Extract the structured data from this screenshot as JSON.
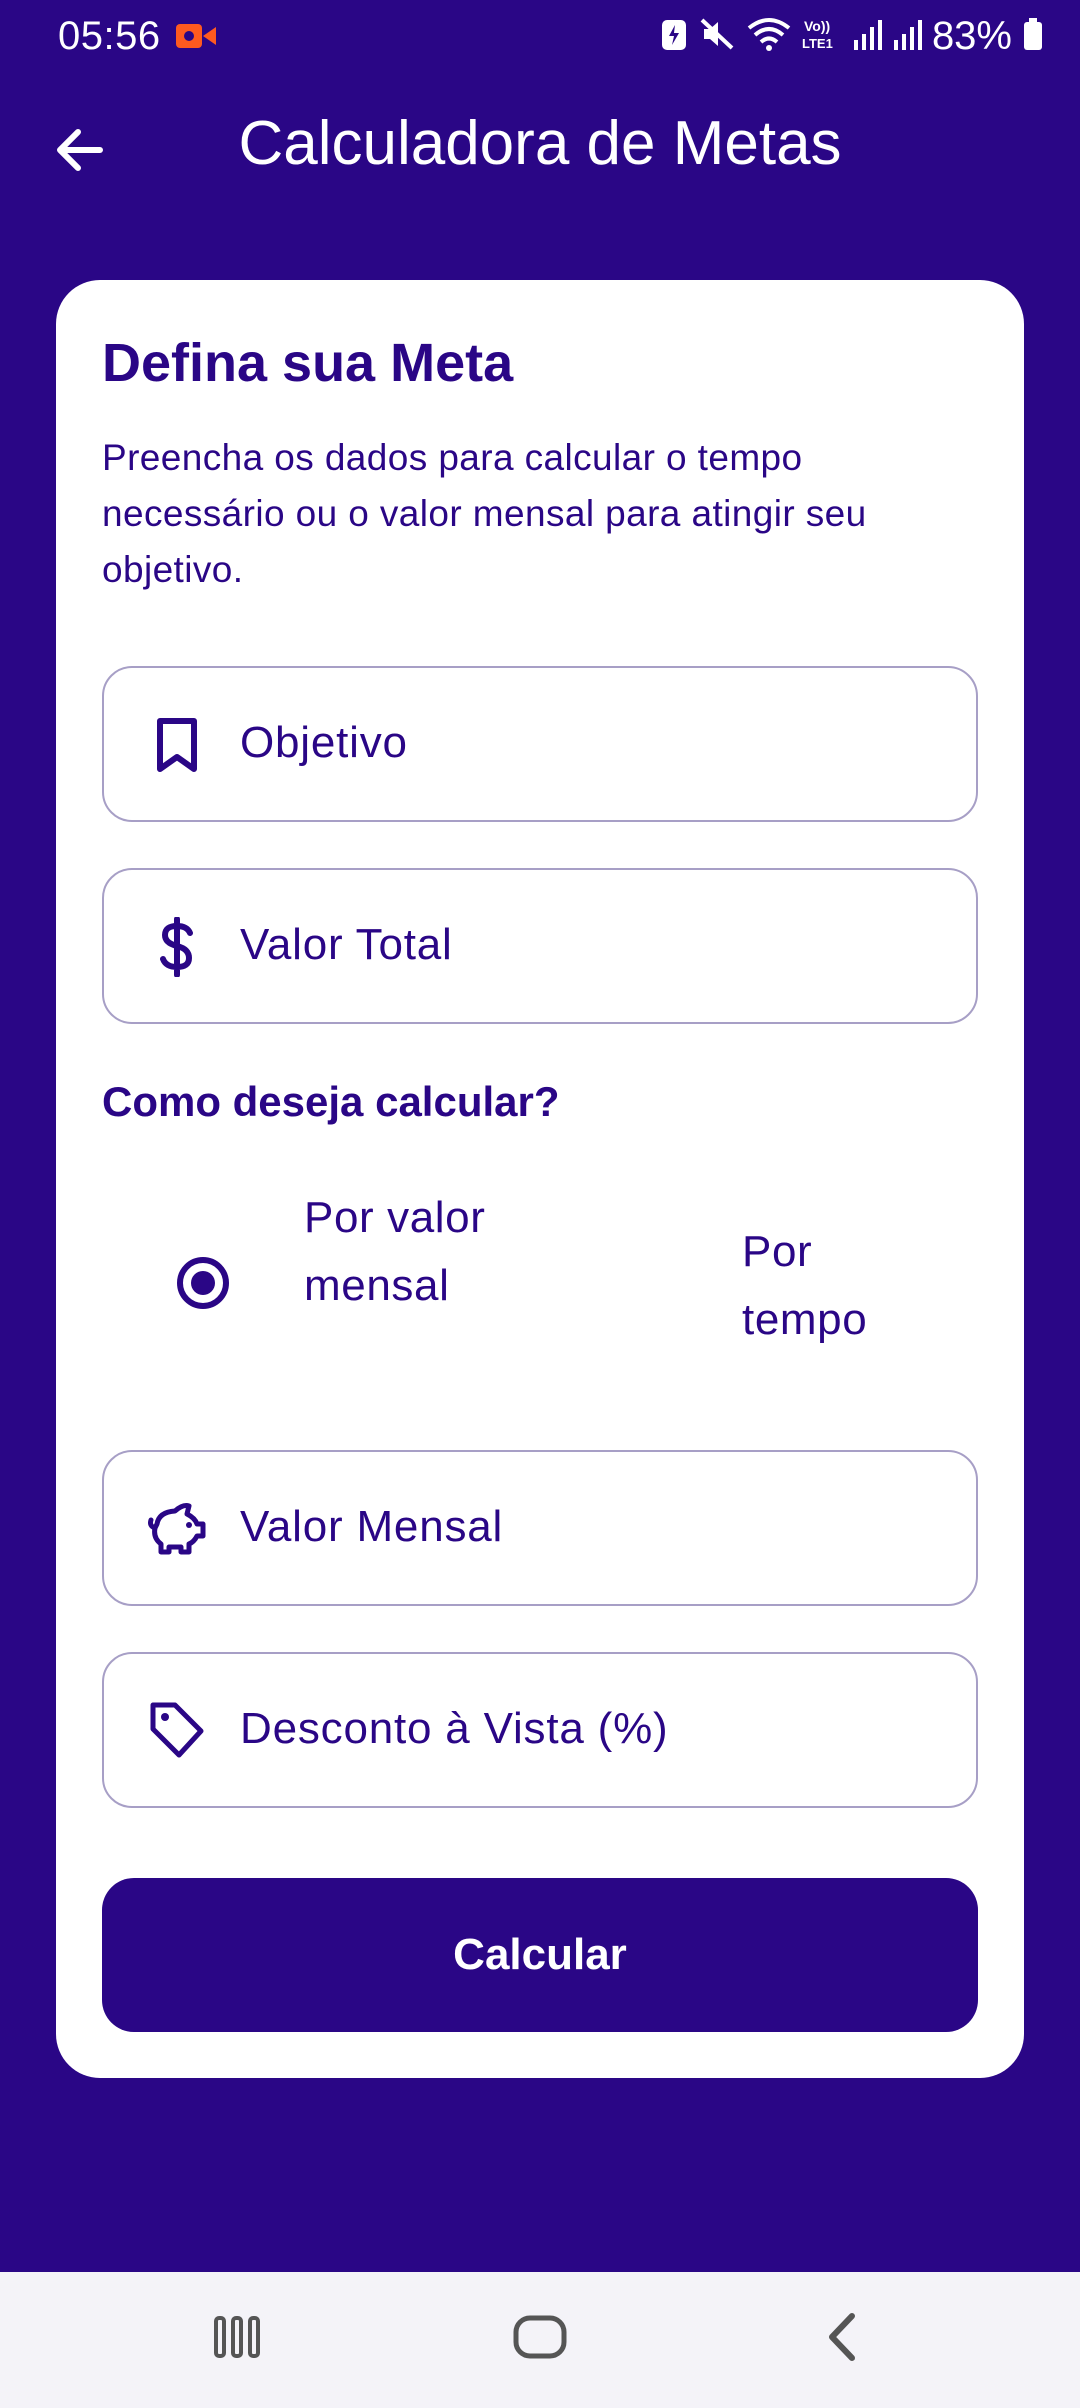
{
  "status_bar": {
    "time": "05:56",
    "battery": "83%",
    "icons": [
      "video-record-icon",
      "battery-saver-icon",
      "mute-icon",
      "wifi-icon",
      "volte-icon",
      "signal-icon",
      "signal-icon",
      "battery-icon"
    ]
  },
  "app_bar": {
    "title": "Calculadora de Metas",
    "back_icon": "arrow-left-icon"
  },
  "card": {
    "title": "Defina sua Meta",
    "description": "Preencha os dados para calcular o tempo necessário ou o valor mensal para atingir seu objetivo.",
    "fields": {
      "objective": {
        "label": "Objetivo",
        "icon": "bookmark-icon"
      },
      "total": {
        "label": "Valor Total",
        "icon": "dollar-icon"
      },
      "monthly": {
        "label": "Valor Mensal",
        "icon": "piggy-bank-icon"
      },
      "discount": {
        "label": "Desconto à Vista (%)",
        "icon": "tag-icon"
      }
    },
    "calc_mode": {
      "question": "Como deseja calcular?",
      "options": [
        {
          "label": "Por valor mensal",
          "selected": true
        },
        {
          "label": "Por tempo",
          "selected": false
        }
      ]
    },
    "button_label": "Calcular"
  },
  "colors": {
    "primary": "#2a0686",
    "surface": "#ffffff",
    "outline": "#a79fc6",
    "nav_bg": "#f4f3f8"
  },
  "nav_bar": {
    "icons": [
      "recent-apps-icon",
      "home-icon",
      "back-icon"
    ]
  }
}
